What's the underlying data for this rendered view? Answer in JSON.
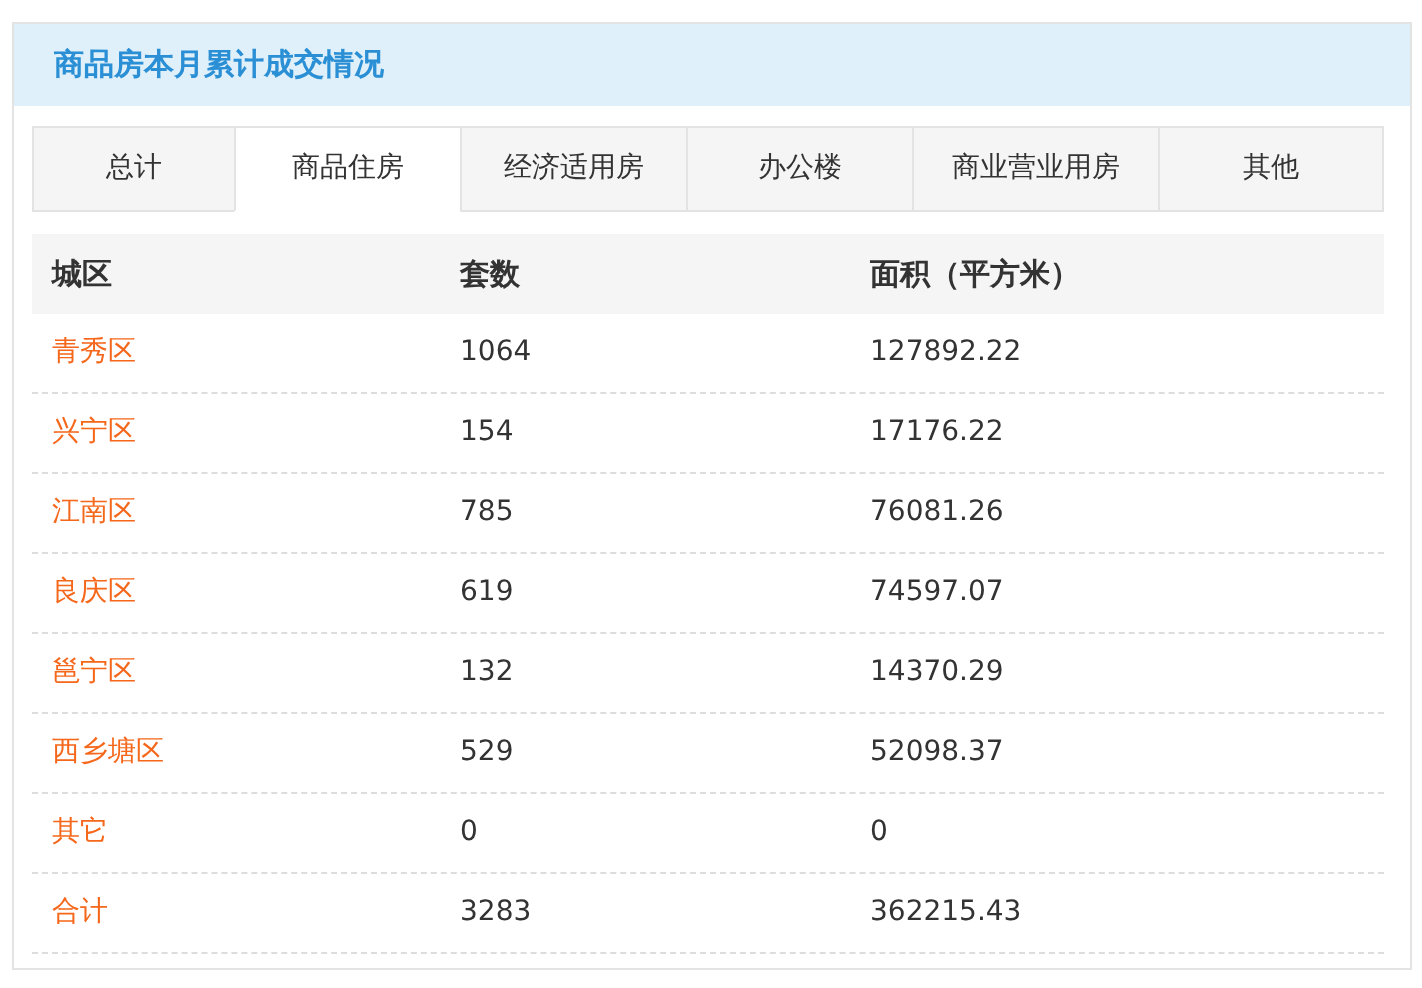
{
  "panel": {
    "title": "商品房本月累计成交情况"
  },
  "tabs": [
    {
      "label": "总计",
      "selected": false
    },
    {
      "label": "商品住房",
      "selected": true
    },
    {
      "label": "经济适用房",
      "selected": false
    },
    {
      "label": "办公楼",
      "selected": false
    },
    {
      "label": "商业营业用房",
      "selected": false
    },
    {
      "label": "其他",
      "selected": false
    }
  ],
  "table": {
    "columns": [
      "城区",
      "套数",
      "面积（平方米）"
    ],
    "rows": [
      [
        "青秀区",
        "1064",
        "127892.22"
      ],
      [
        "兴宁区",
        "154",
        "17176.22"
      ],
      [
        "江南区",
        "785",
        "76081.26"
      ],
      [
        "良庆区",
        "619",
        "74597.07"
      ],
      [
        "邕宁区",
        "132",
        "14370.29"
      ],
      [
        "西乡塘区",
        "529",
        "52098.37"
      ],
      [
        "其它",
        "0",
        "0"
      ],
      [
        "合计",
        "3283",
        "362215.43"
      ]
    ]
  }
}
